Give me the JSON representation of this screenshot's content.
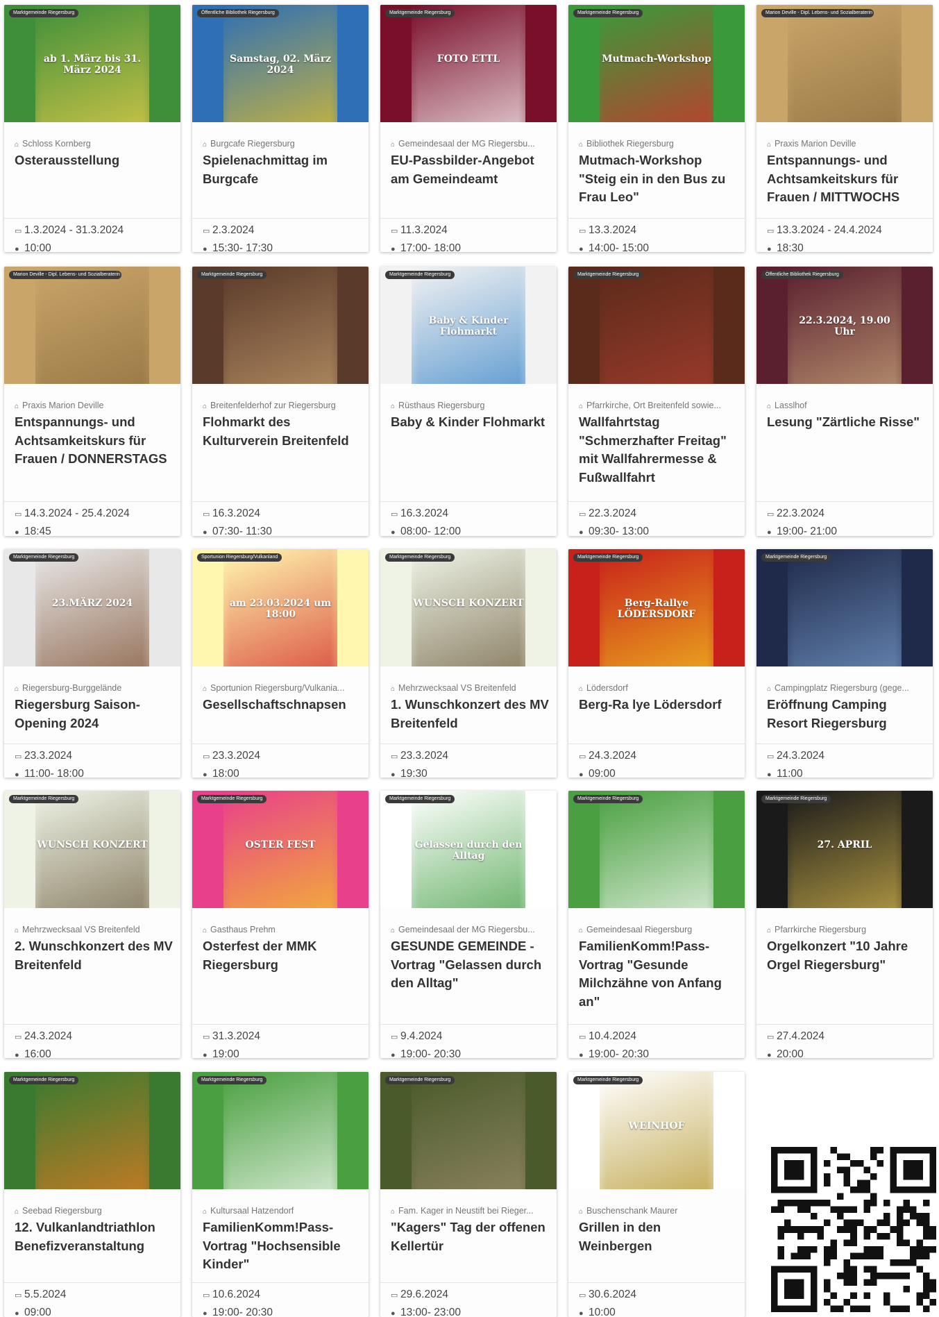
{
  "events": [
    {
      "chip": "Marktgemeinde Riegersburg",
      "location": "Schloss Kornberg",
      "title": "Osterausstellung",
      "date": "1.3.2024 - 31.3.2024",
      "time": "10:00",
      "poster_bg": "#3f8f3a",
      "poster_accent": "#f5d24a",
      "poster_text": "ab 1. März bis 31. März 2024"
    },
    {
      "chip": "Öffentliche Bibliothek Riegersburg",
      "location": "Burgcafe Riegersburg",
      "title": "Spielenachmittag im Burgcafe",
      "date": "2.3.2024",
      "time": "15:30- 17:30",
      "poster_bg": "#2e6fb5",
      "poster_accent": "#f4c81c",
      "poster_text": "Samstag, 02. März 2024"
    },
    {
      "chip": "Marktgemeinde Riegersburg",
      "location": "Gemeindesaal der MG Riegersbu...",
      "title": "EU-Passbilder-Angebot am Gemeindeamt",
      "date": "11.3.2024",
      "time": "17:00- 18:00",
      "poster_bg": "#7a0f2a",
      "poster_accent": "#ffffff",
      "poster_text": "FOTO ETTL"
    },
    {
      "chip": "Marktgemeinde Riegersburg",
      "location": "Bibliothek Riegersburg",
      "title": "Mutmach-Workshop \"Steig ein in den Bus zu Frau Leo\"",
      "date": "13.3.2024",
      "time": "14:00- 15:00",
      "poster_bg": "#3a9a3a",
      "poster_accent": "#e3242b",
      "poster_text": "Mutmach-Workshop"
    },
    {
      "chip": "Marion Deville - Dipl. Lebens- und Sozialberaterin",
      "location": "Praxis Marion Deville",
      "title": "Entspannungs- und Achtsamkeitskurs für Frauen / MITTWOCHS",
      "date": "13.3.2024 - 24.4.2024",
      "time": "18:30",
      "poster_bg": "#c9a56a",
      "poster_accent": "#8a6a3a",
      "poster_text": ""
    },
    {
      "chip": "Marion Deville - Dipl. Lebens- und Sozialberaterin",
      "location": "Praxis Marion Deville",
      "title": "Entspannungs- und Achtsamkeitskurs für Frauen / DONNERSTAGS",
      "date": "14.3.2024 - 25.4.2024",
      "time": "18:45",
      "poster_bg": "#c9a56a",
      "poster_accent": "#8a6a3a",
      "poster_text": ""
    },
    {
      "chip": "Marktgemeinde Riegersburg",
      "location": "Breitenfelderhof zur Riegersburg",
      "title": "Flohmarkt des Kulturverein Breitenfeld",
      "date": "16.3.2024",
      "time": "07:30- 11:30",
      "poster_bg": "#5a3a2a",
      "poster_accent": "#c8a070",
      "poster_text": ""
    },
    {
      "chip": "Marktgemeinde Riegersburg",
      "location": "Rüsthaus Riegersburg",
      "title": "Baby & Kinder Flohmarkt",
      "date": "16.3.2024",
      "time": "08:00- 12:00",
      "poster_bg": "#f2f2f2",
      "poster_accent": "#2f7fc6",
      "poster_text": "Baby & Kinder Flohmarkt"
    },
    {
      "chip": "Marktgemeinde Riegersburg",
      "location": "Pfarrkirche, Ort Breitenfeld sowie...",
      "title": "Wallfahrtstag \"Schmerzhafter Freitag\" mit Wallfahrermesse & Fußwallfahrt",
      "date": "22.3.2024",
      "time": "09:30- 13:00",
      "poster_bg": "#5a2a1a",
      "poster_accent": "#b04030",
      "poster_text": ""
    },
    {
      "chip": "Öffentliche Bibliothek Riegersburg",
      "location": "Lasslhof",
      "title": "Lesung \"Zärtliche Risse\"",
      "date": "22.3.2024",
      "time": "19:00- 21:00",
      "poster_bg": "#5a2030",
      "poster_accent": "#d0b080",
      "poster_text": "22.3.2024, 19.00 Uhr"
    },
    {
      "chip": "Marktgemeinde Riegersburg",
      "location": "Riegersburg-Burggelände",
      "title": "Riegersburg Saison-Opening 2024",
      "date": "23.3.2024",
      "time": "11:00- 18:00",
      "poster_bg": "#e8e8e8",
      "poster_accent": "#7a4a2a",
      "poster_text": "23.MÄRZ 2024"
    },
    {
      "chip": "Sportunion Riegersburg/Vulkanland",
      "location": "Sportunion Riegersburg/Vulkania...",
      "title": "Gesellschaftschnapsen",
      "date": "23.3.2024",
      "time": "18:00",
      "poster_bg": "#fff7b0",
      "poster_accent": "#d02020",
      "poster_text": "am 23.03.2024 um 18:00"
    },
    {
      "chip": "Marktgemeinde Riegersburg",
      "location": "Mehrzwecksaal VS Breitenfeld",
      "title": "1. Wunschkonzert des MV Breitenfeld",
      "date": "23.3.2024",
      "time": "19:30",
      "poster_bg": "#eef3e6",
      "poster_accent": "#6a5a3a",
      "poster_text": "WUNSCH KONZERT"
    },
    {
      "chip": "Marktgemeinde Riegersburg",
      "location": "Lödersdorf",
      "title": "Berg-Ra lye Lödersdorf",
      "date": "24.3.2024",
      "time": "09:00",
      "poster_bg": "#c8201a",
      "poster_accent": "#f5d020",
      "poster_text": "Berg-Rallye LÖDERSDORF"
    },
    {
      "chip": "Marktgemeinde Riegersburg",
      "location": "Campingplatz Riegersburg (gege...",
      "title": "Eröffnung Camping Resort Riegersburg",
      "date": "24.3.2024",
      "time": "11:00",
      "poster_bg": "#1f2a4a",
      "poster_accent": "#7aa0d0",
      "poster_text": ""
    },
    {
      "chip": "Marktgemeinde Riegersburg",
      "location": "Mehrzwecksaal VS Breitenfeld",
      "title": "2. Wunschkonzert des MV Breitenfeld",
      "date": "24.3.2024",
      "time": "16:00",
      "poster_bg": "#eef3e6",
      "poster_accent": "#6a5a3a",
      "poster_text": "WUNSCH KONZERT"
    },
    {
      "chip": "Marktgemeinde Riegersburg",
      "location": "Gasthaus Prehm",
      "title": "Osterfest der MMK Riegersburg",
      "date": "31.3.2024",
      "time": "19:00",
      "poster_bg": "#e8408a",
      "poster_accent": "#f5d020",
      "poster_text": "OSTER FEST"
    },
    {
      "chip": "Marktgemeinde Riegersburg",
      "location": "Gemeindesaal der MG Riegersbu...",
      "title": "GESUNDE GEMEINDE - Vortrag \"Gelassen durch den Alltag\"",
      "date": "9.4.2024",
      "time": "19:00- 20:30",
      "poster_bg": "#ffffff",
      "poster_accent": "#3a9a3a",
      "poster_text": "Gelassen durch den Alltag"
    },
    {
      "chip": "Marktgemeinde Riegersburg",
      "location": "Gemeindesaal Riegersburg",
      "title": "FamilienKomm!Pass-Vortrag \"Gesunde Milchzähne von Anfang an\"",
      "date": "10.4.2024",
      "time": "19:00- 20:30",
      "poster_bg": "#4aa040",
      "poster_accent": "#ffffff",
      "poster_text": ""
    },
    {
      "chip": "Marktgemeinde Riegersburg",
      "location": "Pfarrkirche Riegersburg",
      "title": "Orgelkonzert \"10 Jahre Orgel Riegersburg\"",
      "date": "27.4.2024",
      "time": "20:00",
      "poster_bg": "#1a1a1a",
      "poster_accent": "#e0c050",
      "poster_text": "27. APRIL"
    },
    {
      "chip": "Marktgemeinde Riegersburg",
      "location": "Seebad Riegersburg",
      "title": "12. Vulkanlandtriathlon Benefizveranstaltung",
      "date": "5.5.2024",
      "time": "09:00",
      "poster_bg": "#3a7a30",
      "poster_accent": "#f07a20",
      "poster_text": ""
    },
    {
      "chip": "Marktgemeinde Riegersburg",
      "location": "Kultursaal Hatzendorf",
      "title": "FamilienKomm!Pass-Vortrag \"Hochsensible Kinder\"",
      "date": "10.6.2024",
      "time": "19:00- 20:30",
      "poster_bg": "#4aa040",
      "poster_accent": "#ffffff",
      "poster_text": ""
    },
    {
      "chip": "Marktgemeinde Riegersburg",
      "location": "Fam. Kager in Neustift bei Rieger...",
      "title": "\"Kagers\" Tag der offenen Kellertür",
      "date": "29.6.2024",
      "time": "13:00- 23:00",
      "poster_bg": "#4a5a2a",
      "poster_accent": "#a09070",
      "poster_text": ""
    },
    {
      "chip": "Marktgemeinde Riegersburg",
      "location": "Buschenschank Maurer",
      "title": "Grillen in den Weinbergen",
      "date": "30.6.2024",
      "time": "10:00",
      "poster_bg": "#ffffff",
      "poster_accent": "#b09020",
      "poster_text": "WEINHOF"
    }
  ],
  "icons": {
    "location": "home-pin-icon",
    "date": "calendar-icon",
    "time": "clock-icon"
  },
  "qr_label": "qr-code"
}
